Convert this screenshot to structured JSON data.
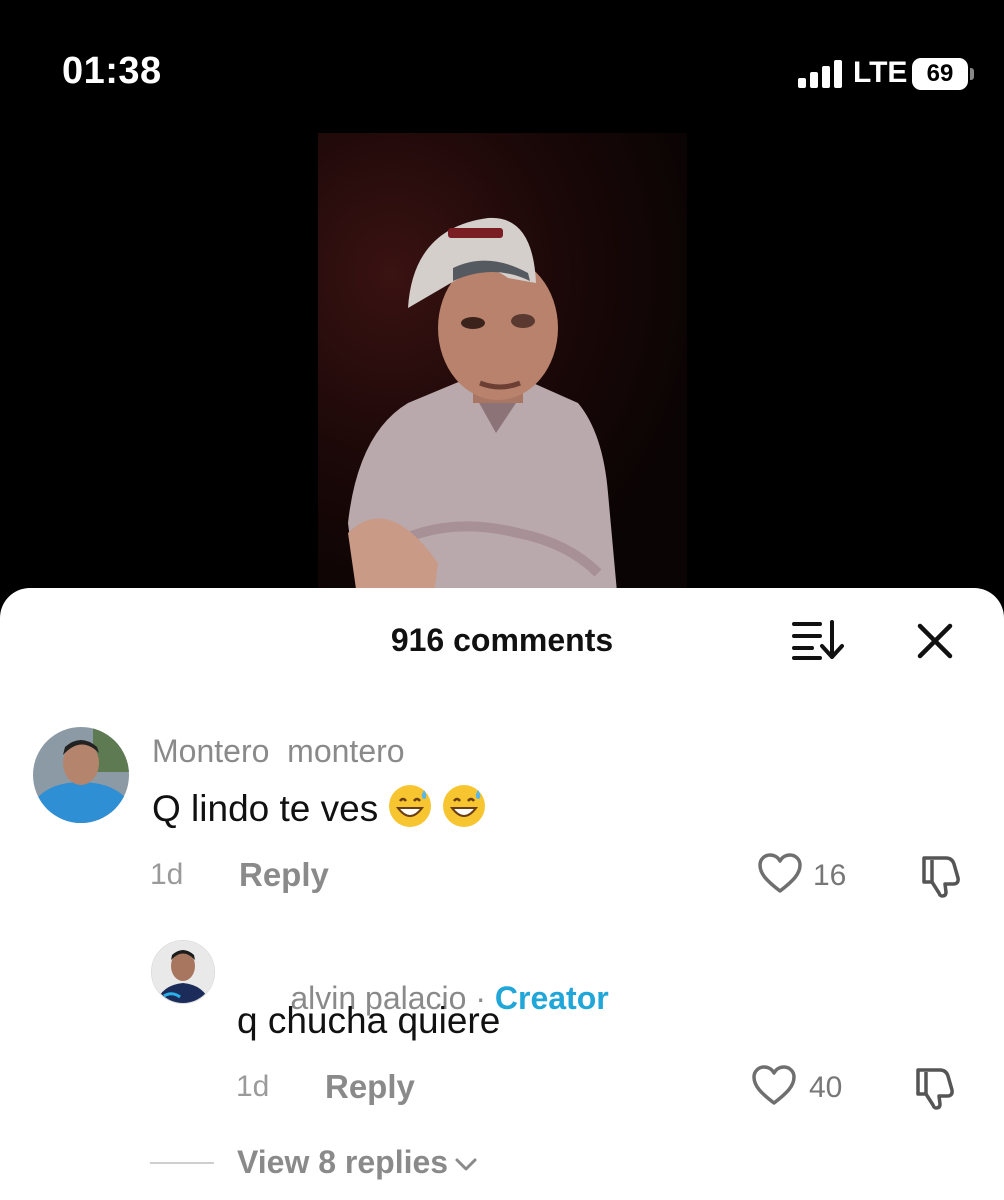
{
  "status_bar": {
    "time": "01:38",
    "network": "LTE",
    "battery": "69"
  },
  "video": {
    "description_icon": "video-frame"
  },
  "comments": {
    "title": "916 comments",
    "sort_icon": "sort-icon",
    "close_icon": "close-icon",
    "items": [
      {
        "username": "Montero  montero",
        "text": "Q lindo te ves",
        "emoji": [
          "😅",
          "😅"
        ],
        "time": "1d",
        "reply_label": "Reply",
        "likes": "16"
      },
      {
        "username": "alvin palacio",
        "separator": "·",
        "badge": "Creator",
        "text": "q chucha quiere",
        "time": "1d",
        "reply_label": "Reply",
        "likes": "40"
      }
    ],
    "view_replies": "View 8 replies"
  },
  "colors": {
    "creator_badge": "#20a6d8",
    "text_primary": "#111111",
    "text_secondary": "#8a8a8a"
  }
}
